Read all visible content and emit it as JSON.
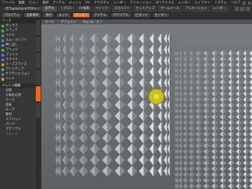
{
  "menu": [
    "ファイル",
    "編集",
    "ビュー",
    "選択",
    "アイテム",
    "メッシュ",
    "UV",
    "テクスチャ",
    "レンダー",
    "アニメーション",
    "ダイナミクス",
    "レンダー",
    "レイアウト",
    "システム",
    "ヘルプ"
  ],
  "layout": {
    "selector": "デフォルトレイアウト"
  },
  "tabs": [
    "モデル",
    "トポロジ",
    "UV編集",
    "ペイント",
    "スカルプト",
    "セットアップ",
    "ゲームツール",
    "アニメーション",
    "レンダー"
  ],
  "toolbar": {
    "buttons": [
      "プロパティ",
      "自動選択",
      "頂点",
      "エッジ",
      "ポリゴン",
      "アイテム",
      "マテリアル",
      "ピボット",
      "センター"
    ],
    "active_index": 4
  },
  "left_panel": {
    "header": "ツール",
    "items_top": [
      "ボックス",
      "スフィア",
      "ベベル",
      "スムースシフト",
      "押し出し",
      "ブリッジ",
      "プッシュ",
      "スライド",
      "ループスライス",
      "プリミティブ",
      "サブディビジョン",
      "ベンド"
    ],
    "section": "メッシュ編集",
    "items_bottom": [
      "分割",
      "三角形分割",
      "マージ",
      "反転",
      "ループ",
      "整列",
      "スプリット",
      "パーツ",
      "マテリアル",
      "スムース"
    ]
  },
  "viewport": {
    "header": [
      "パース",
      "デフォルト",
      "Ray GL: オフ"
    ]
  },
  "colors": {
    "accent": "#e56a1a",
    "background": "#6a6d70",
    "mesh": "#b9bcbf"
  }
}
